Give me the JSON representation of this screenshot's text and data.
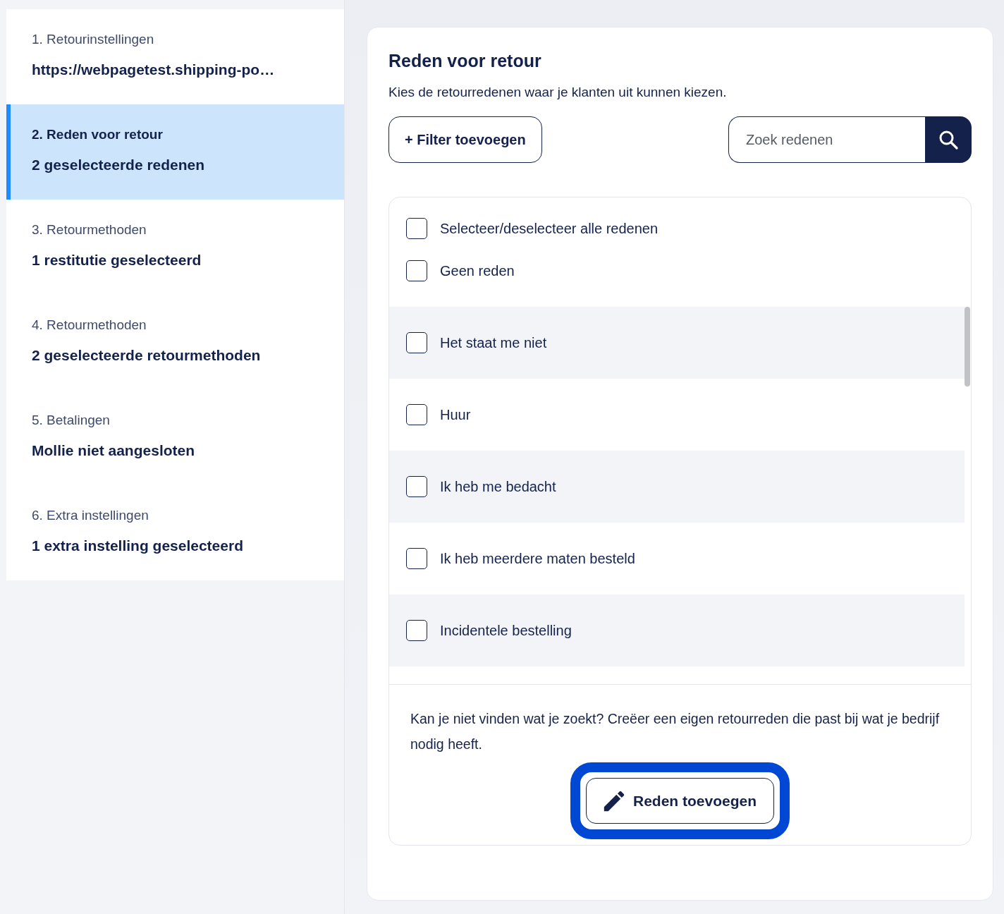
{
  "sidebar": {
    "steps": [
      {
        "label": "1. Retourinstellingen",
        "value": "https://webpagetest.shipping-po…",
        "selected": false
      },
      {
        "label": "2. Reden voor retour",
        "value": "2 geselecteerde redenen",
        "selected": true
      },
      {
        "label": "3. Retourmethoden",
        "value": "1 restitutie geselecteerd",
        "selected": false
      },
      {
        "label": "4. Retourmethoden",
        "value": "2 geselecteerde retourmethoden",
        "selected": false
      },
      {
        "label": "5. Betalingen",
        "value": "Mollie niet aangesloten",
        "selected": false
      },
      {
        "label": "6. Extra instellingen",
        "value": "1 extra instelling geselecteerd",
        "selected": false
      }
    ]
  },
  "panel": {
    "title": "Reden voor retour",
    "subtitle": "Kies de retourredenen waar je klanten uit kunnen kiezen.",
    "filter_button": "+ Filter toevoegen",
    "search": {
      "placeholder": "Zoek redenen"
    },
    "select_all": {
      "label": "Selecteer/deselecteer alle redenen",
      "checked": false
    },
    "reasons": [
      {
        "label": "Geen reden",
        "checked": false
      },
      {
        "label": "Het staat me niet",
        "checked": false
      },
      {
        "label": "Huur",
        "checked": false
      },
      {
        "label": "Ik heb me bedacht",
        "checked": false
      },
      {
        "label": "Ik heb meerdere maten besteld",
        "checked": false
      },
      {
        "label": "Incidentele bestelling",
        "checked": false
      }
    ],
    "footer": {
      "text": "Kan je niet vinden wat je zoekt? Creëer een eigen retourreden die past bij wat je bedrijf nodig heeft.",
      "button": {
        "label": "Reden toevoegen",
        "focused": true
      }
    }
  }
}
